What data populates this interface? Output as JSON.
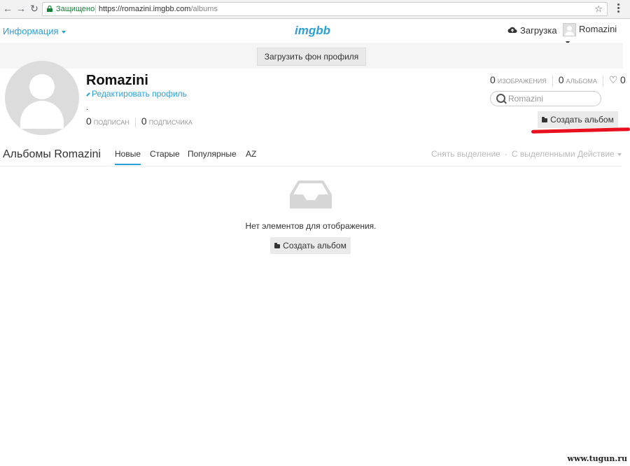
{
  "browser": {
    "secure_label": "Защищено",
    "url_host": "https://romazini.imgbb.com",
    "url_path": "/albums"
  },
  "topbar": {
    "info_menu": "Информация",
    "logo": "imgbb",
    "upload": "Загрузка",
    "username": "Romazini"
  },
  "cover": {
    "button": "Загрузить фон профиля"
  },
  "profile": {
    "name": "Romazini",
    "edit": "Редактировать профиль",
    "bio": ".",
    "following_count": "0",
    "following_label": "подписан",
    "followers_count": "0",
    "followers_label": "подписчика",
    "images_count": "0",
    "images_label": "изображения",
    "albums_count": "0",
    "albums_label": "альбома",
    "likes_count": "0",
    "search_placeholder": "Romazini",
    "create_album": "Создать альбом"
  },
  "albums": {
    "title": "Альбомы Romazini",
    "tabs": [
      {
        "label": "Новые",
        "active": true
      },
      {
        "label": "Старые",
        "active": false
      },
      {
        "label": "Популярные",
        "active": false
      },
      {
        "label": "AZ",
        "active": false
      }
    ],
    "clear_selection": "Снять выделение",
    "selected_action": "С выделенными Действие"
  },
  "empty": {
    "message": "Нет элементов для отображения.",
    "create_album": "Создать альбом"
  },
  "colors": {
    "accent": "#2b9fd8",
    "highlight": "#e8101e"
  },
  "watermark": "www.tugun.ru"
}
